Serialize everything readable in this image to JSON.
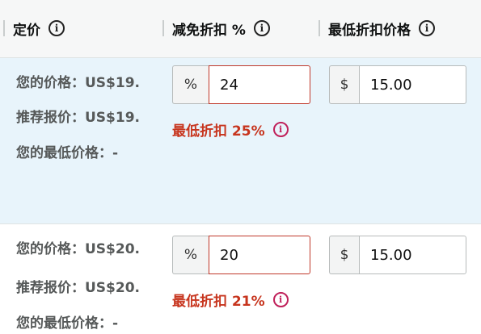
{
  "header": {
    "columns": [
      {
        "label": "定价",
        "icon": "info-icon"
      },
      {
        "label": "减免折扣 %",
        "icon": "info-icon"
      },
      {
        "label": "最低折扣价格",
        "icon": "info-icon"
      }
    ]
  },
  "rows": [
    {
      "your_price": "您的价格：US$19.",
      "list_price": "推荐报价：US$19.",
      "lowest_price": "您的最低价格：-",
      "discount_prefix": "%",
      "discount_value": "24",
      "min_price_prefix": "$",
      "min_price_value": "15.00",
      "warning": "最低折扣 25%",
      "selected": true
    },
    {
      "your_price": "您的价格：US$20.",
      "list_price": "推荐报价：US$20.",
      "lowest_price": "您的最低价格：-",
      "discount_prefix": "%",
      "discount_value": "20",
      "min_price_prefix": "$",
      "min_price_value": "15.00",
      "warning": "最低折扣 21%",
      "selected": false
    }
  ],
  "colors": {
    "selected_row_bg": "#e8f4fb",
    "warning_text": "#c7351e",
    "error_border": "#c0392b"
  }
}
